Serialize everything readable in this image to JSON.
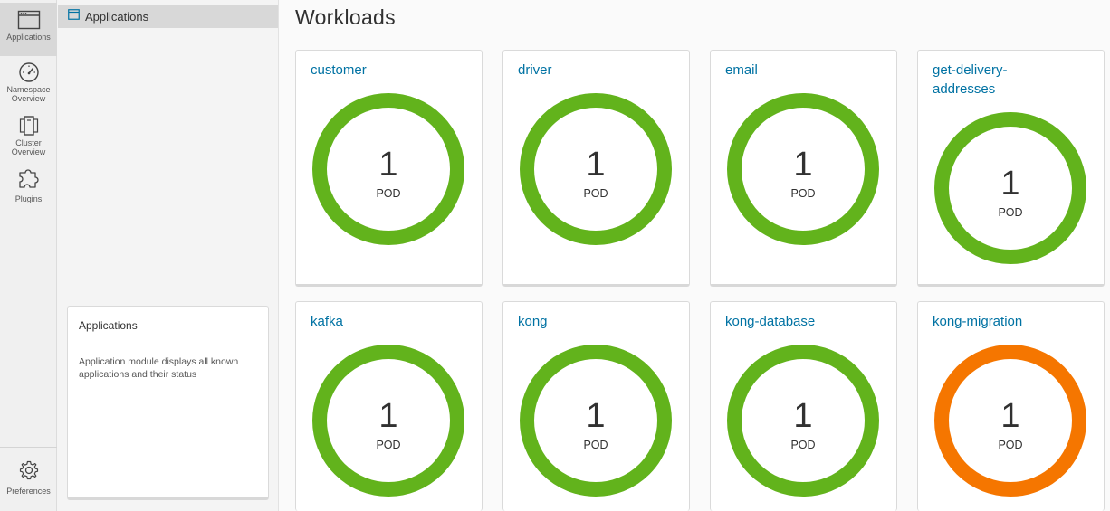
{
  "rail": {
    "items": [
      {
        "label": "Applications",
        "icon": "browser-window-icon",
        "active": true
      },
      {
        "label": "Namespace Overview",
        "icon": "dashboard-gauge-icon",
        "active": false
      },
      {
        "label": "Cluster Overview",
        "icon": "cluster-icon",
        "active": false
      },
      {
        "label": "Plugins",
        "icon": "puzzle-piece-icon",
        "active": false
      }
    ],
    "preferences_label": "Preferences"
  },
  "subnav": {
    "item_label": "Applications",
    "help_title": "Applications",
    "help_body": "Application module displays all known applications and their status"
  },
  "main": {
    "title": "Workloads",
    "unit_label": "POD",
    "workloads": [
      {
        "name": "customer",
        "count": "1",
        "status": "ok"
      },
      {
        "name": "driver",
        "count": "1",
        "status": "ok"
      },
      {
        "name": "email",
        "count": "1",
        "status": "ok"
      },
      {
        "name": "get-delivery-addresses",
        "count": "1",
        "status": "ok"
      },
      {
        "name": "kafka",
        "count": "1",
        "status": "ok"
      },
      {
        "name": "kong",
        "count": "1",
        "status": "ok"
      },
      {
        "name": "kong-database",
        "count": "1",
        "status": "ok"
      },
      {
        "name": "kong-migration",
        "count": "1",
        "status": "warning"
      }
    ]
  },
  "colors": {
    "ok": "#62b31c",
    "warning": "#f57600",
    "link": "#0072a3"
  }
}
